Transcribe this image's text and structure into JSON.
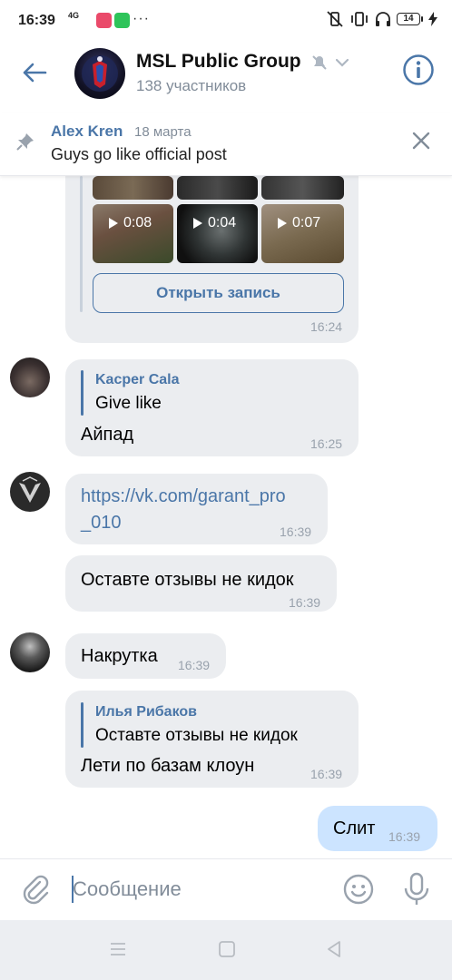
{
  "status": {
    "time": "16:39",
    "network": "4G",
    "battery": "14",
    "dots": "···"
  },
  "header": {
    "title": "MSL Public Group",
    "subtitle": "138 участников"
  },
  "pinned": {
    "author": "Alex Kren",
    "date": "18 марта",
    "text": "Guys go like official post"
  },
  "messages": {
    "post": {
      "videos": [
        "0:08",
        "0:04",
        "0:07"
      ],
      "open_label": "Открыть запись",
      "time": "16:24"
    },
    "m1": {
      "reply_name": "Kacper Cala",
      "reply_text": "Give like",
      "text": "Айпад",
      "time": "16:25"
    },
    "m2": {
      "text_line1": "https://vk.com/garant_pro",
      "text_line2": "_010",
      "time": "16:39"
    },
    "m3": {
      "text": "Оставте отзывы не кидок",
      "time": "16:39"
    },
    "m4": {
      "text": "Накрутка",
      "time": "16:39"
    },
    "m5": {
      "reply_name": "Илья Рибаков",
      "reply_text": "Оставте отзывы не кидок",
      "text": "Лети по базам клоун",
      "time": "16:39"
    },
    "m6": {
      "text": "Слит",
      "time": "16:39"
    }
  },
  "input": {
    "placeholder": "Сообщение"
  },
  "colors": {
    "accent": "#4a76a8",
    "bubble_in": "#ebedf0",
    "bubble_out": "#cce4ff",
    "meta": "#818c99"
  }
}
